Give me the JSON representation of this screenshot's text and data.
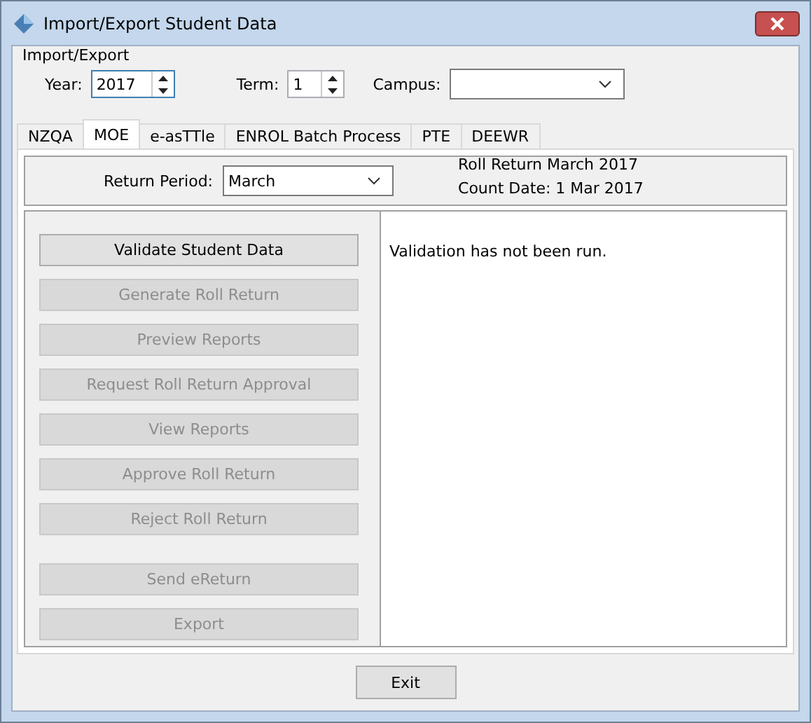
{
  "window": {
    "title": "Import/Export Student Data"
  },
  "group": {
    "title": "Import/Export",
    "year": {
      "label": "Year:",
      "value": "2017"
    },
    "term": {
      "label": "Term:",
      "value": "1"
    },
    "campus": {
      "label": "Campus:"
    }
  },
  "tabs": [
    {
      "label": "NZQA",
      "selected": false
    },
    {
      "label": "MOE",
      "selected": true
    },
    {
      "label": "e-asTTle",
      "selected": false
    },
    {
      "label": "ENROL Batch Process",
      "selected": false
    },
    {
      "label": "PTE",
      "selected": false
    },
    {
      "label": "DEEWR",
      "selected": false
    }
  ],
  "return_period": {
    "label": "Return Period:",
    "value": "March"
  },
  "info": [
    "Roll Return March 2017",
    "Count Date: 1 Mar 2017"
  ],
  "action_groups": [
    [
      {
        "label": "Validate Student Data",
        "disabled": false
      },
      {
        "label": "Generate Roll Return",
        "disabled": true
      },
      {
        "label": "Preview Reports",
        "disabled": true
      },
      {
        "label": "Request Roll Return Approval",
        "disabled": true
      },
      {
        "label": "View Reports",
        "disabled": true
      },
      {
        "label": "Approve Roll Return",
        "disabled": true
      },
      {
        "label": "Reject Roll Return",
        "disabled": true
      }
    ],
    [
      {
        "label": "Send eReturn",
        "disabled": true
      },
      {
        "label": "Export",
        "disabled": true
      }
    ]
  ],
  "message": "Validation has not been run.",
  "buttons": [
    "Exit"
  ]
}
